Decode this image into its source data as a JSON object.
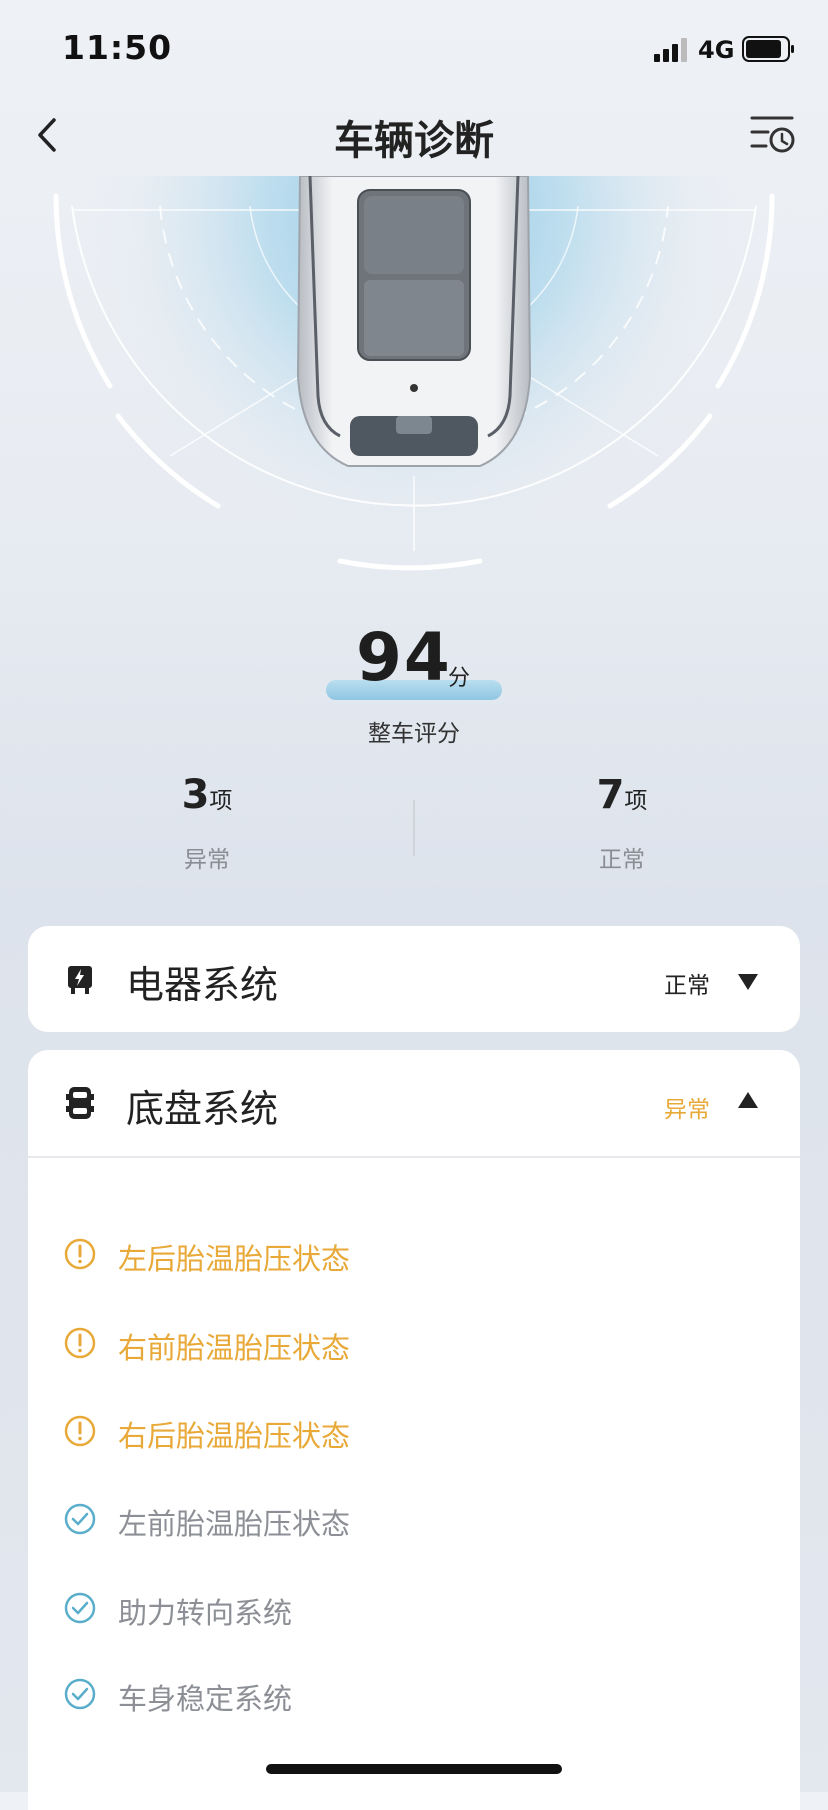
{
  "status_bar": {
    "time": "11:50",
    "network": "4G"
  },
  "nav": {
    "title": "车辆诊断"
  },
  "score": {
    "value": "94",
    "unit": "分",
    "label": "整车评分"
  },
  "stats": {
    "abnormal": {
      "count": "3",
      "unit": "项",
      "label": "异常"
    },
    "normal": {
      "count": "7",
      "unit": "项",
      "label": "正常"
    }
  },
  "systems": {
    "electric": {
      "title": "电器系统",
      "status": "正常",
      "status_color": "#222222",
      "expanded": false,
      "icon": "battery-charging-icon"
    },
    "chassis": {
      "title": "底盘系统",
      "status": "异常",
      "status_color": "#e8a938",
      "expanded": true,
      "icon": "car-chassis-icon",
      "items": [
        {
          "label": "左后胎温胎压状态",
          "state": "warning",
          "icon": "warning-circle-icon"
        },
        {
          "label": "右前胎温胎压状态",
          "state": "warning",
          "icon": "warning-circle-icon"
        },
        {
          "label": "右后胎温胎压状态",
          "state": "warning",
          "icon": "warning-circle-icon"
        },
        {
          "label": "左前胎温胎压状态",
          "state": "ok",
          "icon": "check-circle-icon"
        },
        {
          "label": "助力转向系统",
          "state": "ok",
          "icon": "check-circle-icon"
        },
        {
          "label": "车身稳定系统",
          "state": "ok",
          "icon": "check-circle-icon"
        }
      ]
    }
  },
  "colors": {
    "warning": "#e8a938",
    "ok_icon": "#5aaecb",
    "ok_text": "#8c8f95",
    "accent_bar": "#8fc6e2"
  }
}
